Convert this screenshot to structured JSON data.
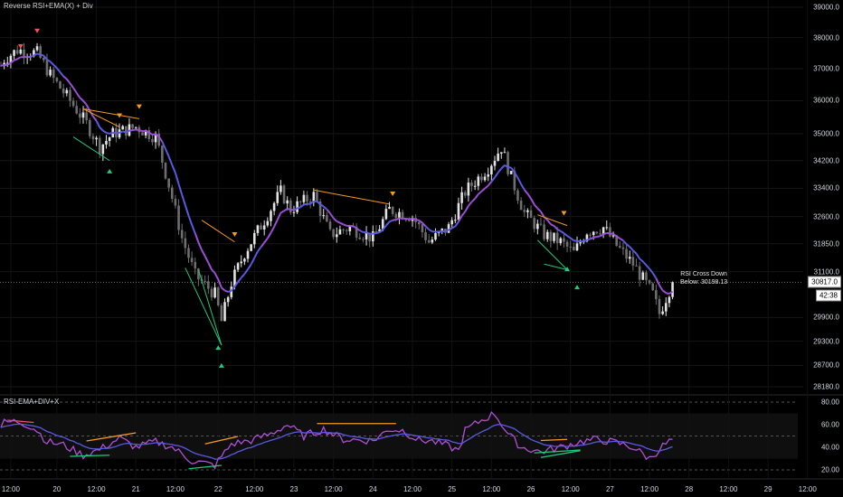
{
  "indicators": {
    "price_title": "Reverse RSI+EMA(X) + Div",
    "rsi_title": "RSI-EMA+DIV+X"
  },
  "alert": {
    "line1": "RSI Cross Down",
    "line2": "Below: 30198.13"
  },
  "last_price": "30817.0",
  "countdown": "42:38",
  "colors": {
    "up": "#e3e3e3",
    "down": "#6e6e6e",
    "ema": "#9b4fd6",
    "ema2": "#5a5ae0",
    "rsi": "#b04fd8",
    "bear": "#f59a23",
    "bull": "#22c97a",
    "red": "#f0525f"
  },
  "chart_data": [
    {
      "type": "candlestick",
      "title": "Reverse RSI+EMA(X) + Div",
      "scale": "log",
      "ylim": [
        28000,
        39300
      ],
      "y_ticks": [
        "39000.0",
        "38000.0",
        "37000.0",
        "36000.0",
        "35000.0",
        "34200.0",
        "33400.0",
        "32600.0",
        "31850.0",
        "31100.0",
        "29900.0",
        "29300.0",
        "28700.0",
        "28180.0"
      ],
      "x_unit": "hourly bar index",
      "x_ticks": [
        {
          "bar": 3,
          "label": "12:00"
        },
        {
          "bar": 17,
          "label": "20"
        },
        {
          "bar": 29,
          "label": "12:00"
        },
        {
          "bar": 41,
          "label": "21"
        },
        {
          "bar": 53,
          "label": "12:00"
        },
        {
          "bar": 66,
          "label": "22"
        },
        {
          "bar": 77,
          "label": "12:00"
        },
        {
          "bar": 89,
          "label": "23"
        },
        {
          "bar": 101,
          "label": "12:00"
        },
        {
          "bar": 113,
          "label": "24"
        },
        {
          "bar": 125,
          "label": "12:00"
        },
        {
          "bar": 137,
          "label": "25"
        },
        {
          "bar": 149,
          "label": "12:00"
        },
        {
          "bar": 161,
          "label": "26"
        },
        {
          "bar": 173,
          "label": "12:00"
        },
        {
          "bar": 185,
          "label": "27"
        },
        {
          "bar": 197,
          "label": "12:00"
        },
        {
          "bar": 209,
          "label": "28"
        },
        {
          "bar": 221,
          "label": "12:00"
        },
        {
          "bar": 233,
          "label": "29"
        },
        {
          "bar": 245,
          "label": "12:00"
        }
      ],
      "close_keypoints": [
        [
          0,
          37100
        ],
        [
          1,
          37300
        ],
        [
          5,
          37600
        ],
        [
          11,
          37500
        ],
        [
          15,
          36800
        ],
        [
          21,
          36000
        ],
        [
          26,
          35300
        ],
        [
          30,
          34600
        ],
        [
          34,
          35000
        ],
        [
          41,
          35200
        ],
        [
          47,
          34900
        ],
        [
          51,
          33500
        ],
        [
          55,
          32000
        ],
        [
          59,
          31000
        ],
        [
          65,
          30500
        ],
        [
          67,
          29800
        ],
        [
          70,
          30800
        ],
        [
          74,
          31600
        ],
        [
          80,
          32500
        ],
        [
          85,
          33300
        ],
        [
          88,
          32800
        ],
        [
          95,
          33200
        ],
        [
          100,
          32100
        ],
        [
          106,
          32300
        ],
        [
          113,
          32000
        ],
        [
          118,
          32800
        ],
        [
          125,
          32600
        ],
        [
          130,
          31900
        ],
        [
          136,
          32300
        ],
        [
          141,
          33300
        ],
        [
          148,
          34000
        ],
        [
          152,
          34600
        ],
        [
          155,
          33700
        ],
        [
          159,
          32700
        ],
        [
          165,
          32100
        ],
        [
          170,
          31900
        ],
        [
          174,
          31600
        ],
        [
          178,
          32200
        ],
        [
          183,
          32300
        ],
        [
          187,
          31800
        ],
        [
          192,
          31300
        ],
        [
          198,
          30500
        ],
        [
          200,
          30000
        ],
        [
          204,
          30817
        ]
      ],
      "divergence_lines": [
        {
          "kind": "bear",
          "from": [
            25,
            35750
          ],
          "to": [
            42,
            35450
          ]
        },
        {
          "kind": "bear",
          "from": [
            25,
            35750
          ],
          "to": [
            36,
            35200
          ]
        },
        {
          "kind": "bull",
          "from": [
            22,
            34900
          ],
          "to": [
            33,
            34200
          ]
        },
        {
          "kind": "bear",
          "from": [
            61,
            32500
          ],
          "to": [
            71,
            31900
          ]
        },
        {
          "kind": "bull",
          "from": [
            56,
            31200
          ],
          "to": [
            67,
            29200
          ]
        },
        {
          "kind": "bull",
          "from": [
            60,
            31150
          ],
          "to": [
            67,
            29200
          ]
        },
        {
          "kind": "bear",
          "from": [
            95,
            33350
          ],
          "to": [
            118,
            32950
          ]
        },
        {
          "kind": "bear",
          "from": [
            163,
            32650
          ],
          "to": [
            172,
            32350
          ]
        },
        {
          "kind": "bull",
          "from": [
            163,
            31950
          ],
          "to": [
            172,
            31150
          ]
        },
        {
          "kind": "bull",
          "from": [
            165,
            31300
          ],
          "to": [
            172,
            31150
          ]
        }
      ],
      "markers": [
        {
          "kind": "red-down",
          "bar": 6,
          "price": 37700
        },
        {
          "kind": "red-down",
          "bar": 11,
          "price": 38200
        },
        {
          "kind": "bear-down",
          "bar": 36,
          "price": 35530
        },
        {
          "kind": "bear-down",
          "bar": 42,
          "price": 35800
        },
        {
          "kind": "bear-down",
          "bar": 71,
          "price": 32090
        },
        {
          "kind": "bear-down",
          "bar": 119,
          "price": 33230
        },
        {
          "kind": "bear-down",
          "bar": 171,
          "price": 32680
        },
        {
          "kind": "bull-up",
          "bar": 33,
          "price": 33880
        },
        {
          "kind": "bull-up",
          "bar": 66,
          "price": 29130
        },
        {
          "kind": "bull-up",
          "bar": 67,
          "price": 28690
        },
        {
          "kind": "bull-up",
          "bar": 172,
          "price": 31160
        },
        {
          "kind": "bull-up",
          "bar": 175,
          "price": 30680
        }
      ]
    },
    {
      "type": "line",
      "title": "RSI-EMA+DIV+X",
      "ylim": [
        14,
        86
      ],
      "y_ticks": [
        "80.00",
        "60.00",
        "40.00",
        "20.00"
      ],
      "band": [
        30,
        70
      ],
      "rsi_keypoints": [
        [
          0,
          58
        ],
        [
          1,
          62
        ],
        [
          5,
          63
        ],
        [
          8,
          60
        ],
        [
          11,
          55
        ],
        [
          14,
          45
        ],
        [
          19,
          42
        ],
        [
          25,
          33
        ],
        [
          30,
          38
        ],
        [
          36,
          48
        ],
        [
          41,
          40
        ],
        [
          47,
          45
        ],
        [
          52,
          40
        ],
        [
          58,
          28
        ],
        [
          65,
          24
        ],
        [
          70,
          43
        ],
        [
          76,
          46
        ],
        [
          82,
          52
        ],
        [
          87,
          60
        ],
        [
          92,
          50
        ],
        [
          98,
          56
        ],
        [
          104,
          47
        ],
        [
          113,
          46
        ],
        [
          118,
          56
        ],
        [
          122,
          55
        ],
        [
          127,
          46
        ],
        [
          130,
          46
        ],
        [
          135,
          42
        ],
        [
          139,
          37
        ],
        [
          141,
          55
        ],
        [
          146,
          64
        ],
        [
          150,
          70
        ],
        [
          154,
          52
        ],
        [
          158,
          40
        ],
        [
          164,
          36
        ],
        [
          170,
          40
        ],
        [
          176,
          45
        ],
        [
          181,
          47
        ],
        [
          187,
          44
        ],
        [
          192,
          40
        ],
        [
          197,
          30
        ],
        [
          201,
          41
        ],
        [
          204,
          47
        ]
      ],
      "divergence_lines": [
        {
          "kind": "red",
          "from": [
            2,
            64
          ],
          "to": [
            10,
            62
          ]
        },
        {
          "kind": "bear",
          "from": [
            26,
            45.6
          ],
          "to": [
            41,
            52.8
          ]
        },
        {
          "kind": "bull",
          "from": [
            21,
            32
          ],
          "to": [
            33,
            33
          ]
        },
        {
          "kind": "bear",
          "from": [
            62,
            43
          ],
          "to": [
            72,
            49.6
          ]
        },
        {
          "kind": "bull",
          "from": [
            57,
            21
          ],
          "to": [
            67,
            24
          ]
        },
        {
          "kind": "bear",
          "from": [
            96,
            61
          ],
          "to": [
            120,
            61
          ]
        },
        {
          "kind": "bear",
          "from": [
            164,
            46
          ],
          "to": [
            172,
            47
          ]
        },
        {
          "kind": "bull",
          "from": [
            162,
            35
          ],
          "to": [
            176,
            37.6
          ]
        },
        {
          "kind": "bull",
          "from": [
            164,
            31
          ],
          "to": [
            176,
            37
          ]
        }
      ]
    }
  ]
}
